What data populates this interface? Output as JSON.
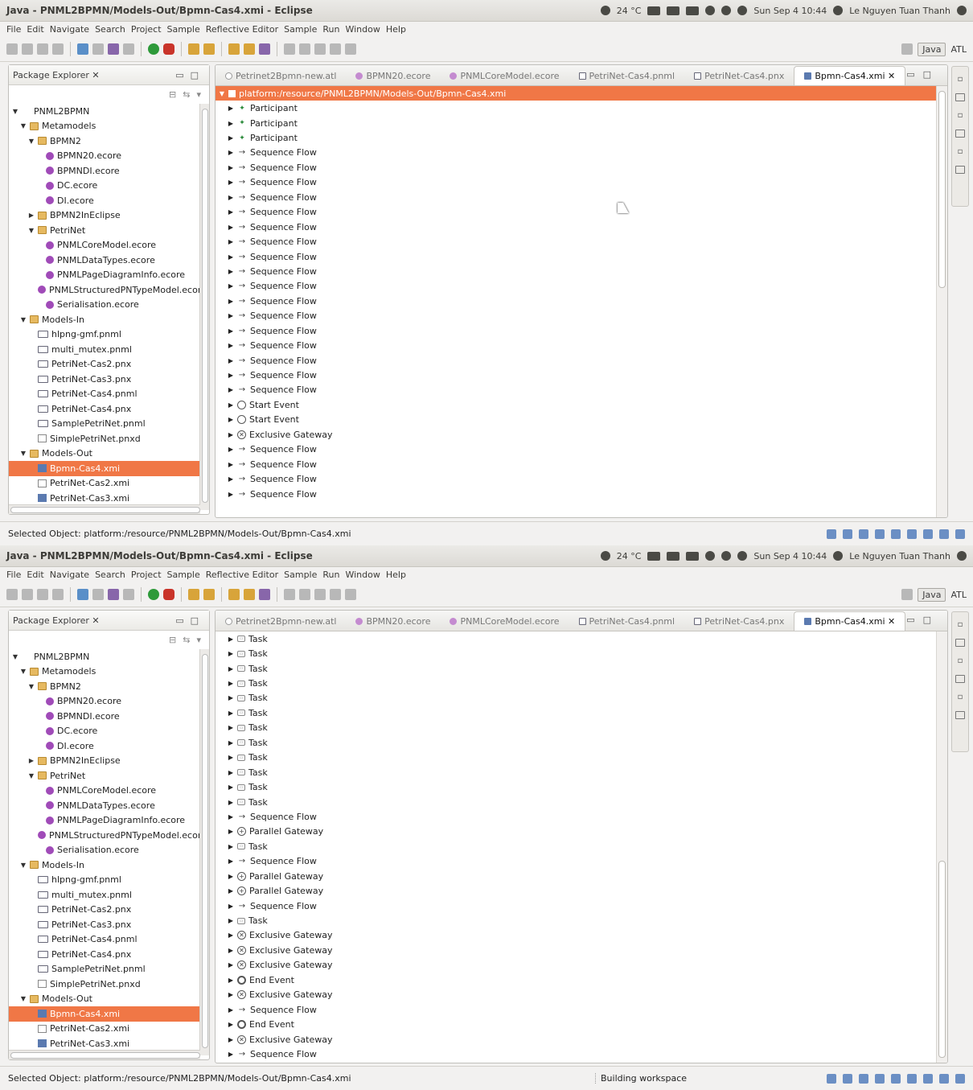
{
  "windows": [
    {
      "title": "Java - PNML2BPMN/Models-Out/Bpmn-Cas4.xmi - Eclipse",
      "tray": {
        "temp": "24 °C",
        "clock": "Sun Sep  4 10:44",
        "user": "Le Nguyen Tuan Thanh"
      },
      "menu": [
        "File",
        "Edit",
        "Navigate",
        "Search",
        "Project",
        "Sample",
        "Reflective Editor",
        "Sample",
        "Run",
        "Window",
        "Help"
      ],
      "perspectives": [
        "Java",
        "ATL"
      ],
      "explorer": {
        "title": "Package Explorer ✕",
        "items": [
          {
            "label": "PNML2BPMN",
            "level": 0,
            "icon": "project-icon",
            "tw": "▼"
          },
          {
            "label": "Metamodels",
            "level": 1,
            "icon": "folder",
            "tw": "▼"
          },
          {
            "label": "BPMN2",
            "level": 2,
            "icon": "folder",
            "tw": "▼"
          },
          {
            "label": "BPMN20.ecore",
            "level": 3,
            "icon": "ecore",
            "tw": ""
          },
          {
            "label": "BPMNDI.ecore",
            "level": 3,
            "icon": "ecore",
            "tw": ""
          },
          {
            "label": "DC.ecore",
            "level": 3,
            "icon": "ecore",
            "tw": ""
          },
          {
            "label": "DI.ecore",
            "level": 3,
            "icon": "ecore",
            "tw": ""
          },
          {
            "label": "BPMN2InEclipse",
            "level": 2,
            "icon": "folder",
            "tw": "▶"
          },
          {
            "label": "PetriNet",
            "level": 2,
            "icon": "folder",
            "tw": "▼"
          },
          {
            "label": "PNMLCoreModel.ecore",
            "level": 3,
            "icon": "ecore",
            "tw": ""
          },
          {
            "label": "PNMLDataTypes.ecore",
            "level": 3,
            "icon": "ecore",
            "tw": ""
          },
          {
            "label": "PNMLPageDiagramInfo.ecore",
            "level": 3,
            "icon": "ecore",
            "tw": ""
          },
          {
            "label": "PNMLStructuredPNTypeModel.ecore",
            "level": 3,
            "icon": "ecore",
            "tw": ""
          },
          {
            "label": "Serialisation.ecore",
            "level": 3,
            "icon": "ecore",
            "tw": ""
          },
          {
            "label": "Models-In",
            "level": 1,
            "icon": "folder",
            "tw": "▼"
          },
          {
            "label": "hlpng-gmf.pnml",
            "level": 2,
            "icon": "pnml",
            "tw": ""
          },
          {
            "label": "multi_mutex.pnml",
            "level": 2,
            "icon": "pnml",
            "tw": ""
          },
          {
            "label": "PetriNet-Cas2.pnx",
            "level": 2,
            "icon": "pnml",
            "tw": ""
          },
          {
            "label": "PetriNet-Cas3.pnx",
            "level": 2,
            "icon": "pnml",
            "tw": ""
          },
          {
            "label": "PetriNet-Cas4.pnml",
            "level": 2,
            "icon": "pnml",
            "tw": ""
          },
          {
            "label": "PetriNet-Cas4.pnx",
            "level": 2,
            "icon": "pnml",
            "tw": ""
          },
          {
            "label": "SamplePetriNet.pnml",
            "level": 2,
            "icon": "pnml",
            "tw": ""
          },
          {
            "label": "SimplePetriNet.pnxd",
            "level": 2,
            "icon": "file",
            "tw": ""
          },
          {
            "label": "Models-Out",
            "level": 1,
            "icon": "folder",
            "tw": "▼"
          },
          {
            "label": "Bpmn-Cas4.xmi",
            "level": 2,
            "icon": "xmi",
            "tw": "",
            "selected": true
          },
          {
            "label": "PetriNet-Cas2.xmi",
            "level": 2,
            "icon": "file",
            "tw": ""
          },
          {
            "label": "PetriNet-Cas3.xmi",
            "level": 2,
            "icon": "xmi",
            "tw": ""
          },
          {
            "label": "Transformation",
            "level": 1,
            "icon": "folder",
            "tw": "▶"
          }
        ]
      },
      "tabs": [
        {
          "label": "Petrinet2Bpmn-new.atl",
          "icon": "atl",
          "active": false
        },
        {
          "label": "BPMN20.ecore",
          "icon": "ecore",
          "active": false
        },
        {
          "label": "PNMLCoreModel.ecore",
          "icon": "ecore",
          "active": false
        },
        {
          "label": "PetriNet-Cas4.pnml",
          "icon": "pn",
          "active": false
        },
        {
          "label": "PetriNet-Cas4.pnx",
          "icon": "pn",
          "active": false
        },
        {
          "label": "Bpmn-Cas4.xmi ✕",
          "icon": "bp",
          "active": true
        }
      ],
      "editor_rows": [
        {
          "label": "platform:/resource/PNML2BPMN/Models-Out/Bpmn-Cas4.xmi",
          "type": "root"
        },
        {
          "label": "Participant",
          "type": "participant"
        },
        {
          "label": "Participant",
          "type": "participant"
        },
        {
          "label": "Participant",
          "type": "participant"
        },
        {
          "label": "Sequence Flow",
          "type": "flow"
        },
        {
          "label": "Sequence Flow",
          "type": "flow"
        },
        {
          "label": "Sequence Flow",
          "type": "flow"
        },
        {
          "label": "Sequence Flow",
          "type": "flow"
        },
        {
          "label": "Sequence Flow",
          "type": "flow"
        },
        {
          "label": "Sequence Flow",
          "type": "flow"
        },
        {
          "label": "Sequence Flow",
          "type": "flow"
        },
        {
          "label": "Sequence Flow",
          "type": "flow"
        },
        {
          "label": "Sequence Flow",
          "type": "flow"
        },
        {
          "label": "Sequence Flow",
          "type": "flow"
        },
        {
          "label": "Sequence Flow",
          "type": "flow"
        },
        {
          "label": "Sequence Flow",
          "type": "flow"
        },
        {
          "label": "Sequence Flow",
          "type": "flow"
        },
        {
          "label": "Sequence Flow",
          "type": "flow"
        },
        {
          "label": "Sequence Flow",
          "type": "flow"
        },
        {
          "label": "Sequence Flow",
          "type": "flow"
        },
        {
          "label": "Sequence Flow",
          "type": "flow"
        },
        {
          "label": "Start Event",
          "type": "start"
        },
        {
          "label": "Start Event",
          "type": "start"
        },
        {
          "label": "Exclusive Gateway",
          "type": "xgw"
        },
        {
          "label": "Sequence Flow",
          "type": "flow"
        },
        {
          "label": "Sequence Flow",
          "type": "flow"
        },
        {
          "label": "Sequence Flow",
          "type": "flow"
        },
        {
          "label": "Sequence Flow",
          "type": "flow"
        }
      ],
      "status": "Selected Object: platform:/resource/PNML2BPMN/Models-Out/Bpmn-Cas4.xmi",
      "status_right": "",
      "scroll_thumb": "upper"
    },
    {
      "title": "Java - PNML2BPMN/Models-Out/Bpmn-Cas4.xmi - Eclipse",
      "tray": {
        "temp": "24 °C",
        "clock": "Sun Sep  4 10:44",
        "user": "Le Nguyen Tuan Thanh"
      },
      "menu": [
        "File",
        "Edit",
        "Navigate",
        "Search",
        "Project",
        "Sample",
        "Reflective Editor",
        "Sample",
        "Run",
        "Window",
        "Help"
      ],
      "perspectives": [
        "Java",
        "ATL"
      ],
      "explorer": {
        "title": "Package Explorer ✕",
        "items": [
          {
            "label": "PNML2BPMN",
            "level": 0,
            "icon": "project-icon",
            "tw": "▼"
          },
          {
            "label": "Metamodels",
            "level": 1,
            "icon": "folder",
            "tw": "▼"
          },
          {
            "label": "BPMN2",
            "level": 2,
            "icon": "folder",
            "tw": "▼"
          },
          {
            "label": "BPMN20.ecore",
            "level": 3,
            "icon": "ecore",
            "tw": ""
          },
          {
            "label": "BPMNDI.ecore",
            "level": 3,
            "icon": "ecore",
            "tw": ""
          },
          {
            "label": "DC.ecore",
            "level": 3,
            "icon": "ecore",
            "tw": ""
          },
          {
            "label": "DI.ecore",
            "level": 3,
            "icon": "ecore",
            "tw": ""
          },
          {
            "label": "BPMN2InEclipse",
            "level": 2,
            "icon": "folder",
            "tw": "▶"
          },
          {
            "label": "PetriNet",
            "level": 2,
            "icon": "folder",
            "tw": "▼"
          },
          {
            "label": "PNMLCoreModel.ecore",
            "level": 3,
            "icon": "ecore",
            "tw": ""
          },
          {
            "label": "PNMLDataTypes.ecore",
            "level": 3,
            "icon": "ecore",
            "tw": ""
          },
          {
            "label": "PNMLPageDiagramInfo.ecore",
            "level": 3,
            "icon": "ecore",
            "tw": ""
          },
          {
            "label": "PNMLStructuredPNTypeModel.ecore",
            "level": 3,
            "icon": "ecore",
            "tw": ""
          },
          {
            "label": "Serialisation.ecore",
            "level": 3,
            "icon": "ecore",
            "tw": ""
          },
          {
            "label": "Models-In",
            "level": 1,
            "icon": "folder",
            "tw": "▼"
          },
          {
            "label": "hlpng-gmf.pnml",
            "level": 2,
            "icon": "pnml",
            "tw": ""
          },
          {
            "label": "multi_mutex.pnml",
            "level": 2,
            "icon": "pnml",
            "tw": ""
          },
          {
            "label": "PetriNet-Cas2.pnx",
            "level": 2,
            "icon": "pnml",
            "tw": ""
          },
          {
            "label": "PetriNet-Cas3.pnx",
            "level": 2,
            "icon": "pnml",
            "tw": ""
          },
          {
            "label": "PetriNet-Cas4.pnml",
            "level": 2,
            "icon": "pnml",
            "tw": ""
          },
          {
            "label": "PetriNet-Cas4.pnx",
            "level": 2,
            "icon": "pnml",
            "tw": ""
          },
          {
            "label": "SamplePetriNet.pnml",
            "level": 2,
            "icon": "pnml",
            "tw": ""
          },
          {
            "label": "SimplePetriNet.pnxd",
            "level": 2,
            "icon": "file",
            "tw": ""
          },
          {
            "label": "Models-Out",
            "level": 1,
            "icon": "folder",
            "tw": "▼"
          },
          {
            "label": "Bpmn-Cas4.xmi",
            "level": 2,
            "icon": "xmi",
            "tw": "",
            "selected": true
          },
          {
            "label": "PetriNet-Cas2.xmi",
            "level": 2,
            "icon": "file",
            "tw": ""
          },
          {
            "label": "PetriNet-Cas3.xmi",
            "level": 2,
            "icon": "xmi",
            "tw": ""
          },
          {
            "label": "Transformation",
            "level": 1,
            "icon": "folder",
            "tw": "▶"
          }
        ]
      },
      "tabs": [
        {
          "label": "Petrinet2Bpmn-new.atl",
          "icon": "atl",
          "active": false
        },
        {
          "label": "BPMN20.ecore",
          "icon": "ecore",
          "active": false
        },
        {
          "label": "PNMLCoreModel.ecore",
          "icon": "ecore",
          "active": false
        },
        {
          "label": "PetriNet-Cas4.pnml",
          "icon": "pn",
          "active": false
        },
        {
          "label": "PetriNet-Cas4.pnx",
          "icon": "pn",
          "active": false
        },
        {
          "label": "Bpmn-Cas4.xmi ✕",
          "icon": "bp",
          "active": true
        }
      ],
      "editor_rows": [
        {
          "label": "Task",
          "type": "task"
        },
        {
          "label": "Task",
          "type": "task"
        },
        {
          "label": "Task",
          "type": "task"
        },
        {
          "label": "Task",
          "type": "task"
        },
        {
          "label": "Task",
          "type": "task"
        },
        {
          "label": "Task",
          "type": "task"
        },
        {
          "label": "Task",
          "type": "task"
        },
        {
          "label": "Task",
          "type": "task"
        },
        {
          "label": "Task",
          "type": "task"
        },
        {
          "label": "Task",
          "type": "task"
        },
        {
          "label": "Task",
          "type": "task"
        },
        {
          "label": "Task",
          "type": "task"
        },
        {
          "label": "Sequence Flow",
          "type": "flow"
        },
        {
          "label": "Parallel Gateway",
          "type": "pgw"
        },
        {
          "label": "Task",
          "type": "task"
        },
        {
          "label": "Sequence Flow",
          "type": "flow"
        },
        {
          "label": "Parallel Gateway",
          "type": "pgw"
        },
        {
          "label": "Parallel Gateway",
          "type": "pgw"
        },
        {
          "label": "Sequence Flow",
          "type": "flow"
        },
        {
          "label": "Task",
          "type": "task"
        },
        {
          "label": "Exclusive Gateway",
          "type": "xgw"
        },
        {
          "label": "Exclusive Gateway",
          "type": "xgw"
        },
        {
          "label": "Exclusive Gateway",
          "type": "xgw"
        },
        {
          "label": "End Event",
          "type": "end"
        },
        {
          "label": "Exclusive Gateway",
          "type": "xgw"
        },
        {
          "label": "Sequence Flow",
          "type": "flow"
        },
        {
          "label": "End Event",
          "type": "end"
        },
        {
          "label": "Exclusive Gateway",
          "type": "xgw"
        },
        {
          "label": "Sequence Flow",
          "type": "flow"
        }
      ],
      "status": "Selected Object: platform:/resource/PNML2BPMN/Models-Out/Bpmn-Cas4.xmi",
      "status_right": "Building workspace",
      "scroll_thumb": "lower"
    }
  ]
}
